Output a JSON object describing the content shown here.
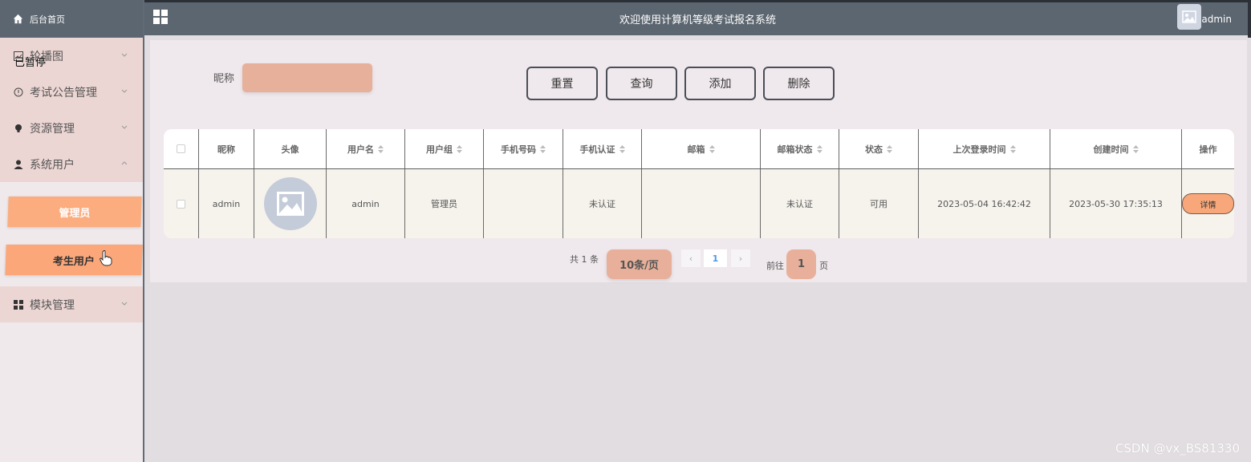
{
  "header": {
    "title": "欢迎使用计算机等级考试报名系统",
    "username": "admin"
  },
  "sidebar": {
    "home": "后台首页",
    "overlay_text": "已暂停",
    "items": [
      {
        "label": "轮播图",
        "icon": "image-icon"
      },
      {
        "label": "考试公告管理",
        "icon": "info-icon"
      },
      {
        "label": "资源管理",
        "icon": "bulb-icon"
      },
      {
        "label": "系统用户",
        "icon": "user-icon"
      },
      {
        "label": "模块管理",
        "icon": "grid-icon"
      }
    ],
    "submenu": [
      "管理员",
      "考生用户"
    ]
  },
  "search": {
    "label": "昵称",
    "value": ""
  },
  "buttons": {
    "reset": "重置",
    "query": "查询",
    "add": "添加",
    "delete": "删除"
  },
  "table": {
    "columns": [
      "昵称",
      "头像",
      "用户名",
      "用户组",
      "手机号码",
      "手机认证",
      "邮箱",
      "邮箱状态",
      "状态",
      "上次登录时间",
      "创建时间",
      "操作"
    ],
    "rows": [
      {
        "nickname": "admin",
        "username": "admin",
        "group": "管理员",
        "phone": "",
        "phone_auth": "未认证",
        "email": "",
        "email_status": "未认证",
        "status": "可用",
        "last_login": "2023-05-04 16:42:42",
        "created": "2023-05-30 17:35:13",
        "action": "详情"
      }
    ]
  },
  "pager": {
    "total": "共 1 条",
    "page_size": "10条/页",
    "prev": "‹",
    "current": "1",
    "next": "›",
    "goto_label": "前往",
    "goto_value": "1",
    "page_unit": "页"
  },
  "watermark": "CSDN @vx_BS81330",
  "colors": {
    "header_bg": "#5c6670",
    "accent": "#fbad7f",
    "input_bg": "#e8b09b",
    "menu_bg": "#ecd6d3"
  }
}
